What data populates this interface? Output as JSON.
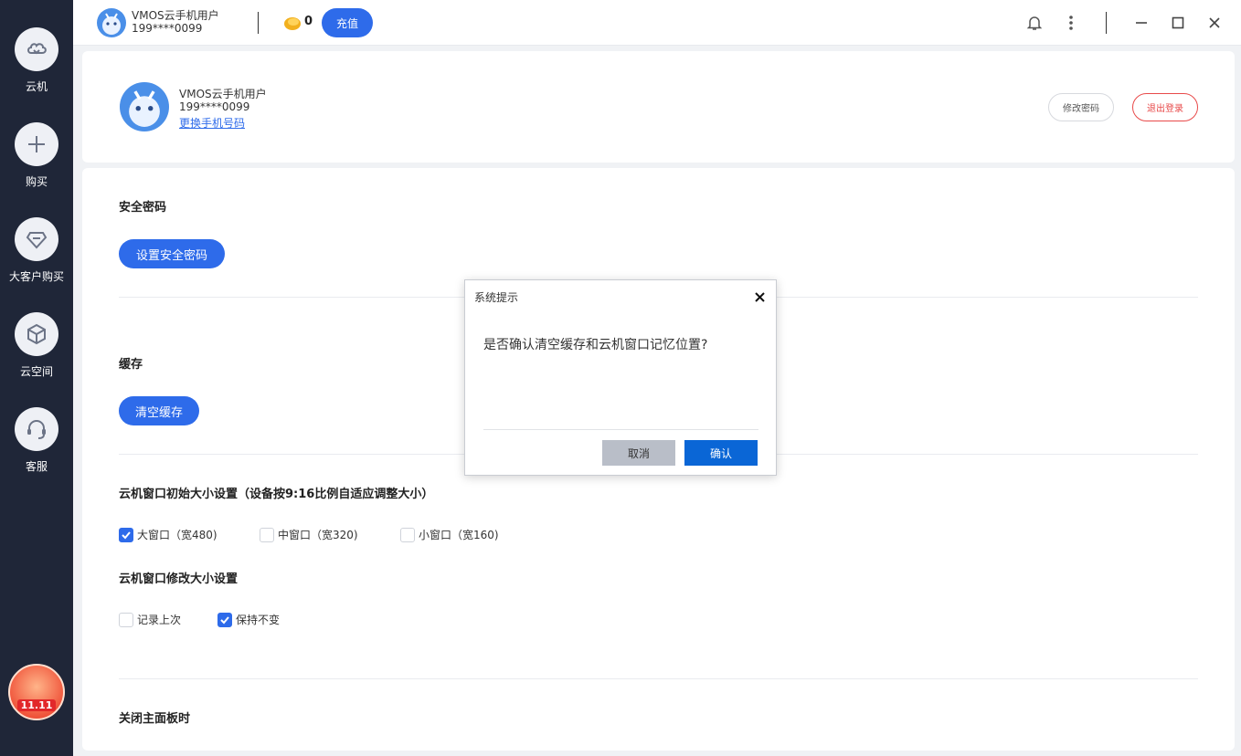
{
  "sidebar": {
    "items": [
      {
        "label": "云机",
        "icon": "cloud-phone-icon"
      },
      {
        "label": "购买",
        "icon": "plus-icon"
      },
      {
        "label": "大客户购买",
        "icon": "diamond-icon"
      },
      {
        "label": "云空间",
        "icon": "cube-icon"
      },
      {
        "label": "客服",
        "icon": "headset-icon"
      }
    ],
    "promo_badge": "11.11"
  },
  "topbar": {
    "user_name": "VMOS云手机用户",
    "user_phone": "199****0099",
    "coin_count": "0",
    "recharge_label": "充值"
  },
  "profile": {
    "name": "VMOS云手机用户",
    "phone": "199****0099",
    "change_phone_link": "更换手机号码",
    "change_password_label": "修改密码",
    "logout_label": "退出登录"
  },
  "settings": {
    "security_title": "安全密码",
    "security_button": "设置安全密码",
    "cache_title": "缓存",
    "cache_button": "清空缓存",
    "window_size_title": "云机窗口初始大小设置（设备按9:16比例自适应调整大小）",
    "window_size_options": [
      {
        "label": "大窗口（宽480)",
        "checked": true
      },
      {
        "label": "中窗口（宽320)",
        "checked": false
      },
      {
        "label": "小窗口（宽160)",
        "checked": false
      }
    ],
    "window_resize_title": "云机窗口修改大小设置",
    "window_resize_options": [
      {
        "label": "记录上次",
        "checked": false
      },
      {
        "label": "保持不变",
        "checked": true
      }
    ],
    "close_panel_title": "关闭主面板时"
  },
  "dialog": {
    "title": "系统提示",
    "message": "是否确认清空缓存和云机窗口记忆位置?",
    "cancel_label": "取消",
    "confirm_label": "确认"
  },
  "colors": {
    "primary": "#2e6bea",
    "sidebar_bg": "#1f2638",
    "danger": "#e84a4a",
    "dialog_confirm": "#0a66d6"
  }
}
